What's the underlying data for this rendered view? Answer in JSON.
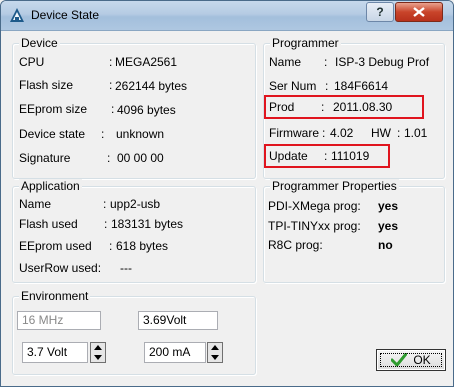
{
  "window": {
    "title": "Device State",
    "help_label": "?"
  },
  "device": {
    "title": "Device",
    "rows": [
      {
        "label": "CPU",
        "sep": ":",
        "value": "MEGA2561"
      },
      {
        "label": "Flash size",
        "sep": ":",
        "value": "262144 bytes"
      },
      {
        "label": "EEprom size",
        "sep": ":",
        "value": "4096 bytes"
      },
      {
        "label": "Device state",
        "sep": ":",
        "value": "unknown"
      },
      {
        "label": "Signature",
        "sep": ":",
        "value": "00 00 00"
      }
    ]
  },
  "programmer": {
    "title": "Programmer",
    "name_label": "Name",
    "name_sep": ":",
    "name_value": "ISP-3 Debug Prof",
    "sernum_label": "Ser Num",
    "sernum_sep": ":",
    "sernum_value": "184F6614",
    "prod_label": "Prod",
    "prod_sep": ":",
    "prod_value": "2011.08.30",
    "firmware_label": "Firmware",
    "firmware_sep": ":",
    "firmware_value": "4.02",
    "hw_label": "HW",
    "hw_sep": ":",
    "hw_value": "1.01",
    "update_label": "Update",
    "update_sep": ":",
    "update_value": "111019"
  },
  "application": {
    "title": "Application",
    "rows": [
      {
        "label": "Name",
        "sep": ":",
        "value": "upp2-usb"
      },
      {
        "label": "Flash used",
        "sep": ":",
        "value": "183131 bytes"
      },
      {
        "label": "EEprom used",
        "sep": ":",
        "value": "618 bytes"
      },
      {
        "label": "UserRow used:",
        "sep": "",
        "value": "---"
      }
    ]
  },
  "programmer_properties": {
    "title": "Programmer Properties",
    "rows": [
      {
        "label": "PDI-XMega prog:",
        "value": "yes"
      },
      {
        "label": "TPI-TINYxx prog:",
        "value": "yes"
      },
      {
        "label": "R8C prog:",
        "value": "no"
      }
    ]
  },
  "environment": {
    "title": "Environment",
    "frequency": "16 MHz",
    "measured_voltage": "3.69Volt",
    "supply_voltage": "3.7  Volt",
    "current_limit": "200 mA"
  },
  "buttons": {
    "ok_label": "OK"
  },
  "colors": {
    "highlight": "#e0141e",
    "ok_check": "#2e9b2e"
  }
}
